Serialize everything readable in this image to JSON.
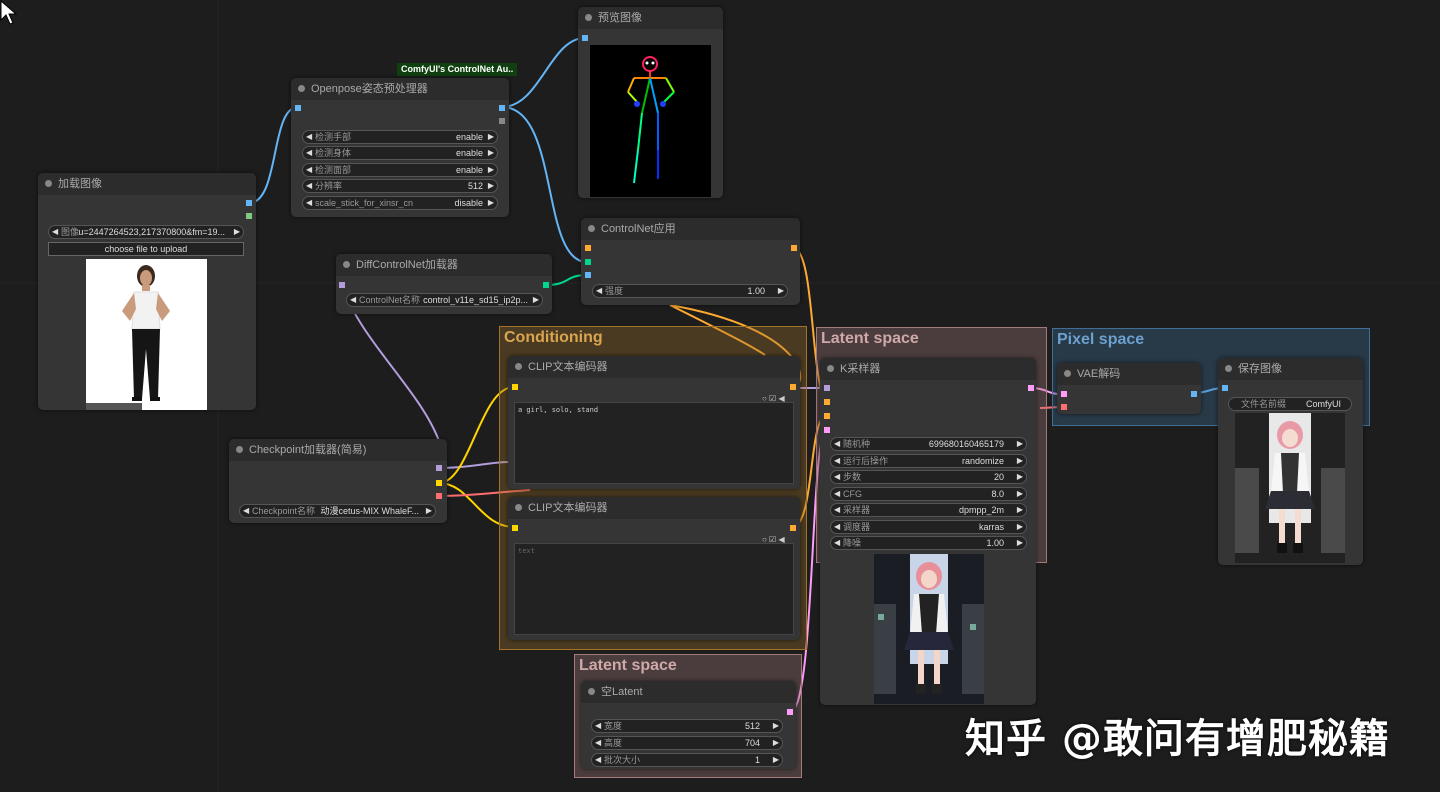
{
  "colors": {
    "image_wire": "#64b5f6",
    "model_wire": "#b39ddb",
    "clip_wire": "#ffd500",
    "vae_wire": "#ff6e6e",
    "conditioning_wire": "#ffa931",
    "latent_wire": "#ff9cf9",
    "control_wire": "#00d78d",
    "conditioning_group": "#a1742a",
    "latent_group": "#a37a7a",
    "pixel_group": "#3f6f99"
  },
  "badge": "ComfyUI's ControlNet Au..",
  "groups": {
    "conditioning": "Conditioning",
    "latent_space_top": "Latent space",
    "pixel_space": "Pixel space",
    "latent_space_bottom": "Latent space"
  },
  "nodes": {
    "load_image": {
      "title": "加载图像",
      "image_label": "图像",
      "image_value": "u=2447264523,217370800&fm=19...",
      "upload_button": "choose file to upload"
    },
    "openpose": {
      "title": "Openpose姿态预处理器",
      "widgets": [
        {
          "label": "检测手部",
          "value": "enable"
        },
        {
          "label": "检测身体",
          "value": "enable"
        },
        {
          "label": "检测面部",
          "value": "enable"
        },
        {
          "label": "分辨率",
          "value": "512"
        },
        {
          "label": "scale_stick_for_xinsr_cn",
          "value": "disable"
        }
      ]
    },
    "preview": {
      "title": "预览图像"
    },
    "diff_controlnet": {
      "title": "DiffControlNet加载器",
      "label": "ControlNet名称",
      "value": "control_v11e_sd15_ip2p..."
    },
    "controlnet_apply": {
      "title": "ControlNet应用",
      "label": "强度",
      "value": "1.00"
    },
    "checkpoint": {
      "title": "Checkpoint加载器(简易)",
      "label": "Checkpoint名称",
      "value": "动漫cetus-MIX WhaleF..."
    },
    "clip_pos": {
      "title": "CLIP文本编码器",
      "text": "a girl, solo, stand"
    },
    "clip_neg": {
      "title": "CLIP文本编码器",
      "text": "",
      "placeholder": "text"
    },
    "ksampler": {
      "title": "K采样器",
      "widgets": [
        {
          "label": "随机种",
          "value": "699680160465179"
        },
        {
          "label": "运行后操作",
          "value": "randomize"
        },
        {
          "label": "步数",
          "value": "20"
        },
        {
          "label": "CFG",
          "value": "8.0"
        },
        {
          "label": "采样器",
          "value": "dpmpp_2m"
        },
        {
          "label": "调度器",
          "value": "karras"
        },
        {
          "label": "降噪",
          "value": "1.00"
        }
      ]
    },
    "vae_decode": {
      "title": "VAE解码"
    },
    "save_image": {
      "title": "保存图像",
      "label": "文件名前缀",
      "value": "ComfyUI"
    },
    "empty_latent": {
      "title": "空Latent",
      "widgets": [
        {
          "label": "宽度",
          "value": "512"
        },
        {
          "label": "高度",
          "value": "704"
        },
        {
          "label": "批次大小",
          "value": "1"
        }
      ]
    }
  },
  "watermark": "知乎 @敢问有增肥秘籍",
  "arrows": {
    "left": "◀",
    "right": "▶"
  }
}
